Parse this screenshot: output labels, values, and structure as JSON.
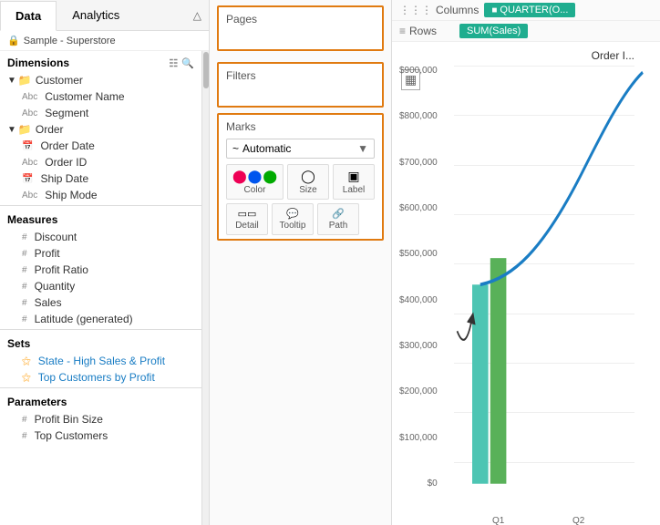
{
  "tabs": {
    "data_label": "Data",
    "analytics_label": "Analytics"
  },
  "datasource": {
    "name": "Sample - Superstore",
    "icon": "🔒"
  },
  "sidebar": {
    "dimensions_label": "Dimensions",
    "measures_label": "Measures",
    "sets_label": "Sets",
    "parameters_label": "Parameters",
    "dimensions": {
      "customer_group": "Customer",
      "customer_items": [
        {
          "label": "Customer Name",
          "type": "Abc"
        },
        {
          "label": "Segment",
          "type": "Abc"
        }
      ],
      "order_group": "Order",
      "order_items": [
        {
          "label": "Order Date",
          "type": "cal"
        },
        {
          "label": "Order ID",
          "type": "Abc"
        },
        {
          "label": "Ship Date",
          "type": "cal"
        },
        {
          "label": "Ship Mode",
          "type": "Abc"
        }
      ]
    },
    "measures": [
      {
        "label": "Discount",
        "type": "#"
      },
      {
        "label": "Profit",
        "type": "#"
      },
      {
        "label": "Profit Ratio",
        "type": "#"
      },
      {
        "label": "Quantity",
        "type": "#"
      },
      {
        "label": "Sales",
        "type": "#"
      },
      {
        "label": "Latitude (generated)",
        "type": "#"
      }
    ],
    "sets": [
      {
        "label": "State - High Sales & Profit",
        "type": "set"
      },
      {
        "label": "Top Customers by Profit",
        "type": "set"
      }
    ],
    "parameters": [
      {
        "label": "Profit Bin Size",
        "type": "#"
      },
      {
        "label": "Top Customers",
        "type": "#"
      }
    ]
  },
  "center": {
    "pages_label": "Pages",
    "filters_label": "Filters",
    "marks_label": "Marks",
    "marks_type": "Automatic",
    "marks_buttons": [
      {
        "label": "Color",
        "icon": "⬤⬤"
      },
      {
        "label": "Size",
        "icon": "◎"
      },
      {
        "label": "Label",
        "icon": "⊞"
      }
    ],
    "marks_detail_buttons": [
      {
        "label": "Detail",
        "icon": "⊡⊡"
      },
      {
        "label": "Tooltip",
        "icon": "💬"
      },
      {
        "label": "Path",
        "icon": "🔗"
      }
    ]
  },
  "chart": {
    "columns_label": "Columns",
    "rows_label": "Rows",
    "columns_pill": "QUARTER(O...",
    "rows_pill": "SUM(Sales)",
    "title": "Order I...",
    "y_labels": [
      "$900,000",
      "$800,000",
      "$700,000",
      "$600,000",
      "$500,000",
      "$400,000",
      "$300,000",
      "$200,000",
      "$100,000",
      "$0"
    ],
    "x_labels": [
      "Q1",
      "Q2"
    ],
    "bars": [
      {
        "x": 10,
        "height_pct": 48,
        "color": "teal"
      },
      {
        "x": 32,
        "height_pct": 55,
        "color": "green"
      }
    ]
  }
}
